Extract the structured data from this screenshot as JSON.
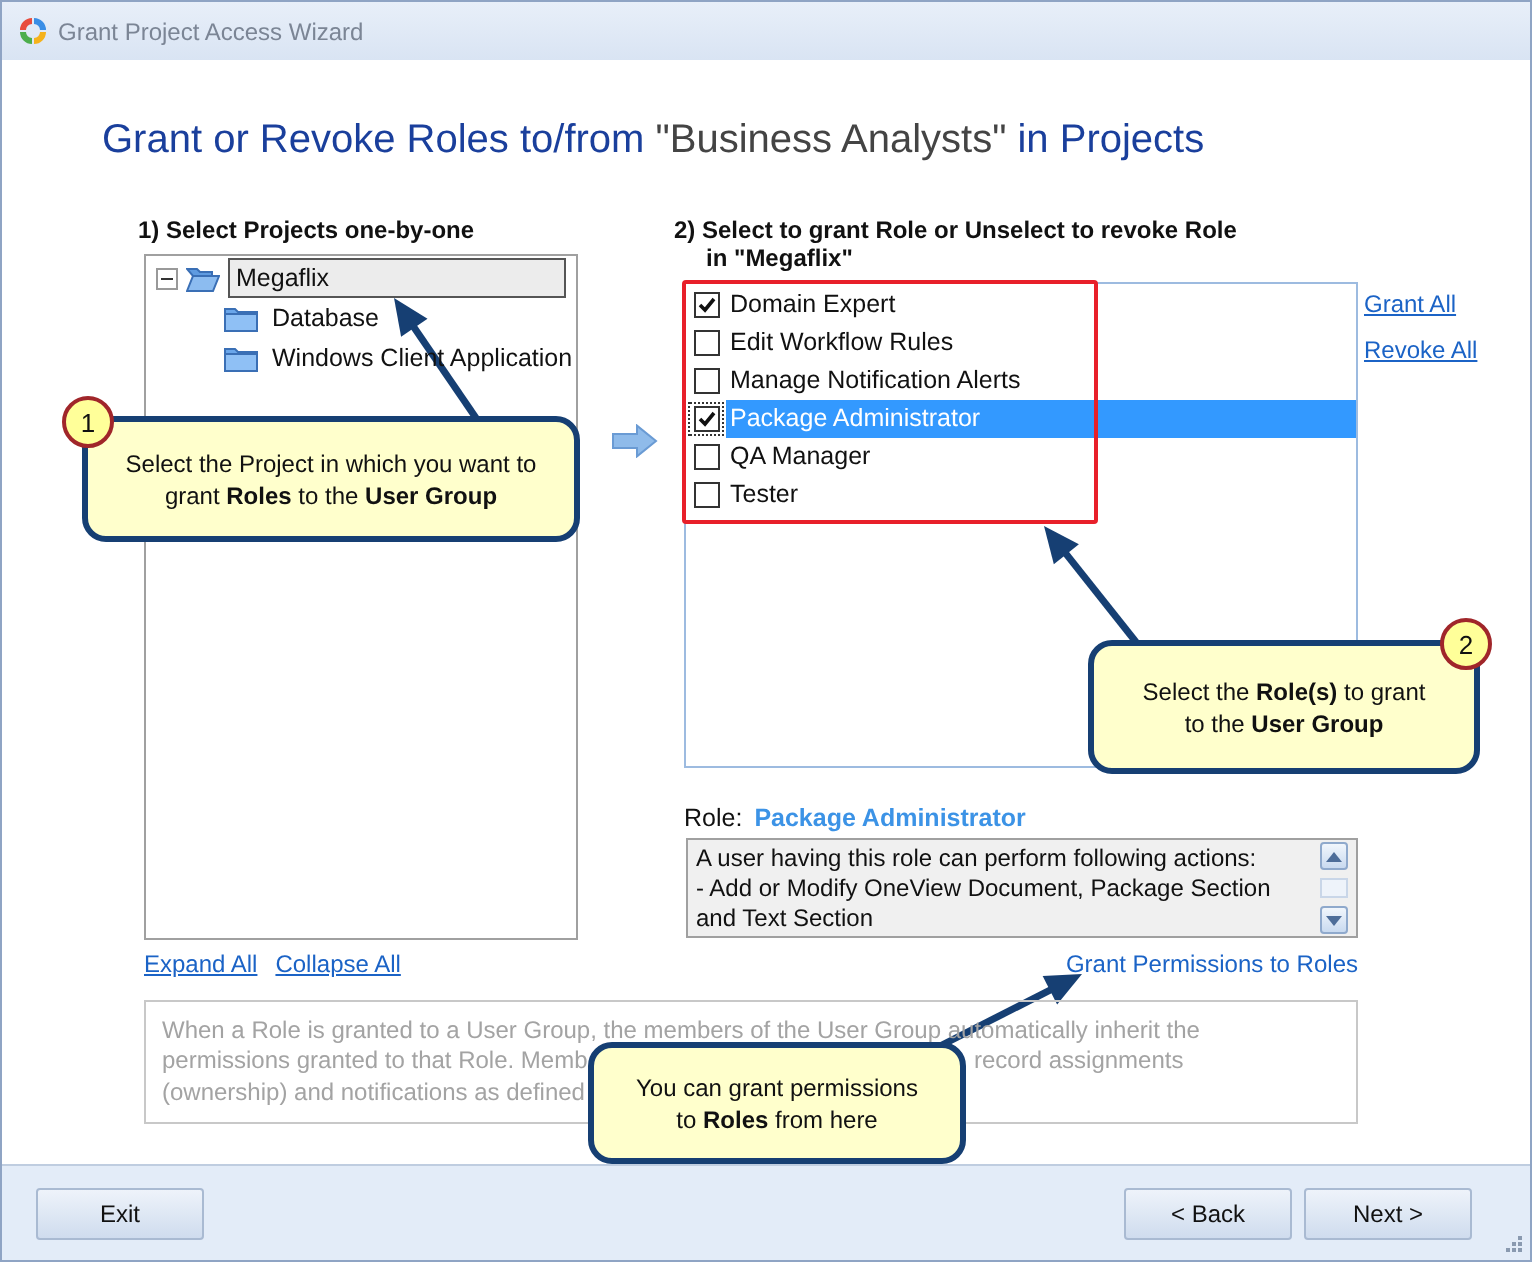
{
  "window": {
    "title": "Grant Project Access Wizard"
  },
  "heading": {
    "prefix": "Grant or Revoke Roles to/from",
    "group": "\"Business Analysts\"",
    "suffix": "in Projects"
  },
  "projects": {
    "label": "1) Select Projects one-by-one",
    "tree": [
      {
        "label": "Megaflix",
        "selected": true,
        "expanded": true,
        "children": [
          {
            "label": "Database",
            "selected": false
          },
          {
            "label": "Windows Client Application",
            "selected": false
          }
        ]
      }
    ],
    "links": [
      "Expand All",
      "Collapse All"
    ]
  },
  "roles": {
    "title": "2) Select to grant Role or Unselect to revoke Role",
    "subtitle": "in \"Megaflix\"",
    "items": [
      {
        "label": "Domain Expert",
        "checked": true,
        "selected": false
      },
      {
        "label": "Edit Workflow Rules",
        "checked": false,
        "selected": false
      },
      {
        "label": "Manage Notification Alerts",
        "checked": false,
        "selected": false
      },
      {
        "label": "Package Administrator",
        "checked": true,
        "selected": true
      },
      {
        "label": "QA Manager",
        "checked": false,
        "selected": false
      },
      {
        "label": "Tester",
        "checked": false,
        "selected": false
      }
    ],
    "links": [
      "Grant All",
      "Revoke All"
    ],
    "detail_label": "Role:",
    "detail_value": "Package Administrator",
    "description": [
      "A user having this role can perform following actions:",
      "- Add or Modify OneView Document, Package Section",
      "and Text Section"
    ],
    "permissions_link": "Grant Permissions to Roles"
  },
  "info_text": [
    [
      "When a Role is granted to a User Group, the members of the User Group automatically inherit the"
    ],
    [
      "permissions granted to that Role. Memb",
      "record assignments"
    ],
    [
      "(ownership) and notifications as defined"
    ]
  ],
  "callouts": [
    {
      "number": "1",
      "text": "Select the Project in which you want to grant **Roles** to the **User Group**"
    },
    {
      "number": "2",
      "text": "Select the **Role(s)** to grant to the **User Group**"
    },
    {
      "text": "You can grant permissions to **Roles** from here"
    }
  ],
  "buttons": [
    {
      "label": "Exit"
    },
    {
      "label": "< Back"
    },
    {
      "label": "Next >"
    }
  ]
}
